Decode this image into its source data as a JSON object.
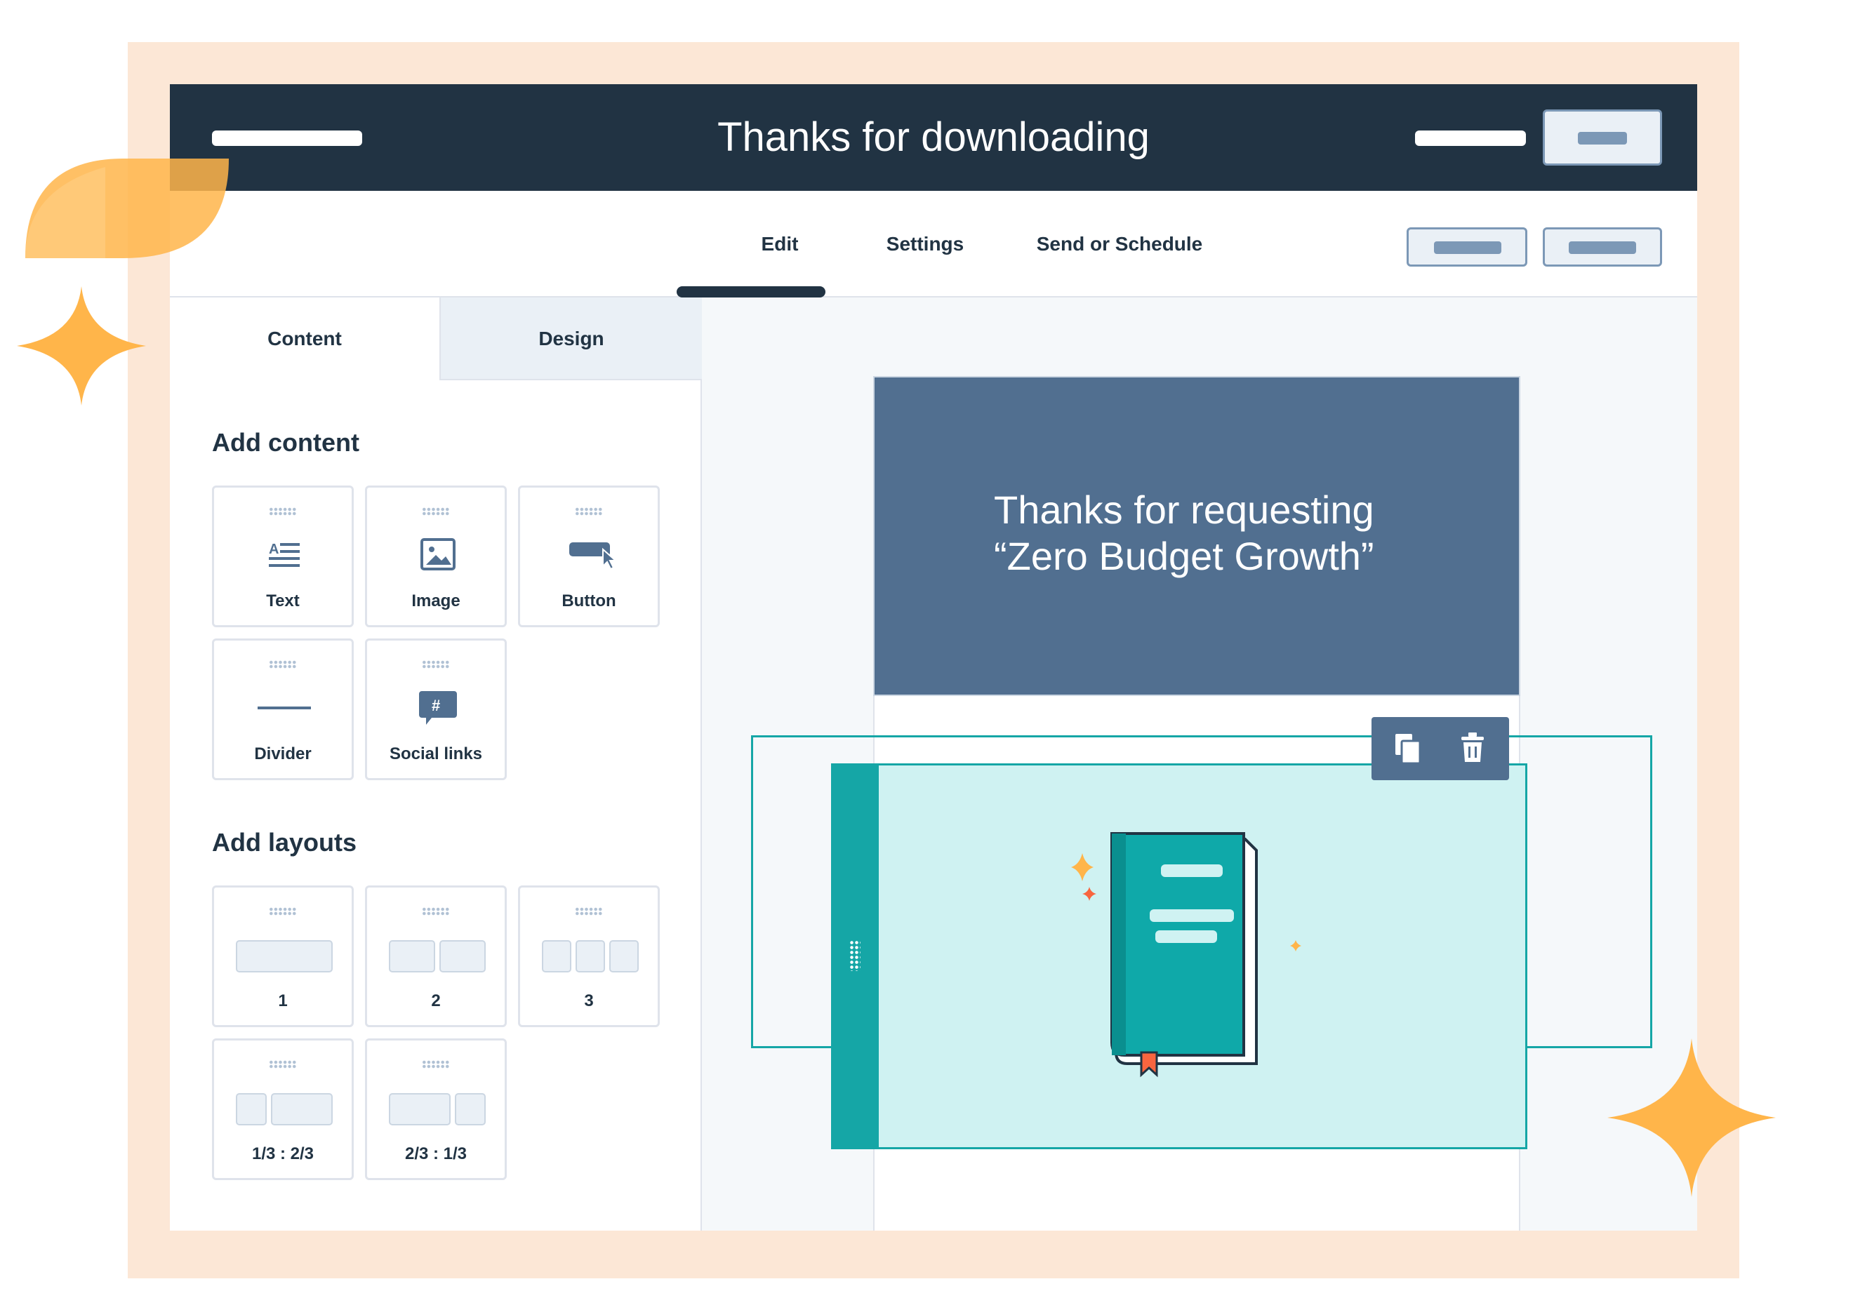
{
  "header": {
    "title": "Thanks for downloading"
  },
  "nav": {
    "tabs": [
      {
        "label": "Edit"
      },
      {
        "label": "Settings"
      },
      {
        "label": "Send or Schedule"
      }
    ]
  },
  "sidebar": {
    "tabs": [
      {
        "label": "Content"
      },
      {
        "label": "Design"
      }
    ],
    "add_content": {
      "title": "Add content",
      "items": [
        {
          "label": "Text",
          "icon": "text-icon"
        },
        {
          "label": "Image",
          "icon": "image-icon"
        },
        {
          "label": "Button",
          "icon": "button-icon"
        },
        {
          "label": "Divider",
          "icon": "divider-icon"
        },
        {
          "label": "Social links",
          "icon": "social-links-icon"
        }
      ]
    },
    "add_layouts": {
      "title": "Add layouts",
      "items": [
        {
          "label": "1"
        },
        {
          "label": "2"
        },
        {
          "label": "3"
        },
        {
          "label": "1/3 : 2/3"
        },
        {
          "label": "2/3 : 1/3"
        }
      ]
    }
  },
  "email": {
    "hero_line1": "Thanks for requesting",
    "hero_line2": "“Zero Budget Growth”",
    "image_icon": "book-icon"
  },
  "toolbar": {
    "clone_icon": "clone-icon",
    "delete_icon": "trash-icon"
  },
  "colors": {
    "header_bg": "#213343",
    "frame_bg": "#fce7d6",
    "accent_teal": "#15a6a6",
    "hero_bg": "#516f90",
    "sparkle": "#ffb54a"
  }
}
